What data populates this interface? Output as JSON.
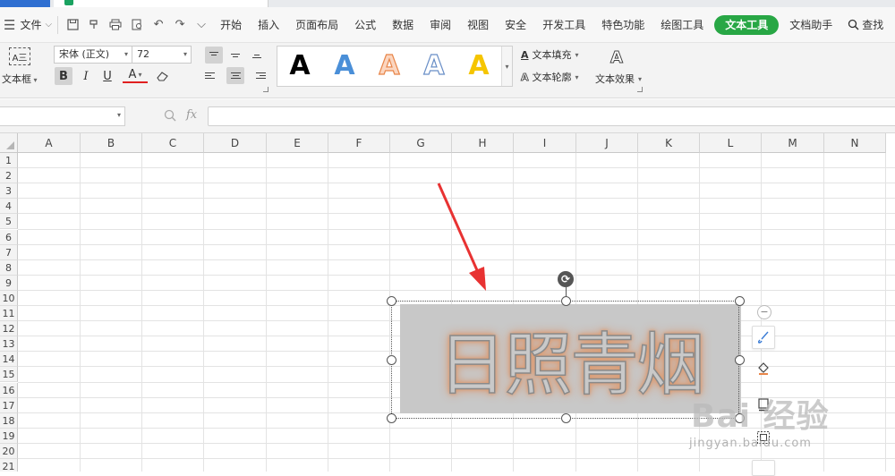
{
  "menubar": {
    "file_label": "文件",
    "tabs": [
      "开始",
      "插入",
      "页面布局",
      "公式",
      "数据",
      "审阅",
      "视图",
      "安全",
      "开发工具",
      "特色功能",
      "绘图工具",
      "文本工具",
      "文档助手"
    ],
    "active_tab": "文本工具",
    "search_label": "查找"
  },
  "ribbon": {
    "textbox_label": "文本框",
    "textbox_icon_text": "A三",
    "font_name": "宋体 (正文)",
    "font_size": "72",
    "bold_label": "B",
    "italic_label": "I",
    "underline_label": "U",
    "font_color_label": "A",
    "styles": [
      {
        "label": "A",
        "color": "#000000"
      },
      {
        "label": "A",
        "color": "#4a8fd8"
      },
      {
        "label": "A",
        "color": "#f0a070"
      },
      {
        "label": "A",
        "color": "#ffffff"
      },
      {
        "label": "A",
        "color": "#f5c500"
      }
    ],
    "text_fill_label": "文本填充",
    "text_outline_label": "文本轮廓",
    "text_effect_label": "文本效果"
  },
  "formula_bar": {
    "fx_label": "fx"
  },
  "sheet": {
    "columns": [
      "A",
      "B",
      "C",
      "D",
      "E",
      "F",
      "G",
      "H",
      "I",
      "J",
      "K",
      "L",
      "M",
      "N"
    ],
    "rows": [
      "1",
      "2",
      "3",
      "4",
      "5",
      "6",
      "7",
      "8",
      "9",
      "10",
      "11",
      "12",
      "13",
      "14",
      "15",
      "16",
      "17",
      "18",
      "19",
      "20",
      "21"
    ]
  },
  "wordart": {
    "text": "日照青烟",
    "fill_color": "#c8c8c8",
    "glow_color": "#d9895a"
  },
  "annotation": {
    "arrow_color": "#e83232"
  },
  "watermark": {
    "main": "Bai 经验",
    "sub": "jingyan.baidu.com"
  }
}
